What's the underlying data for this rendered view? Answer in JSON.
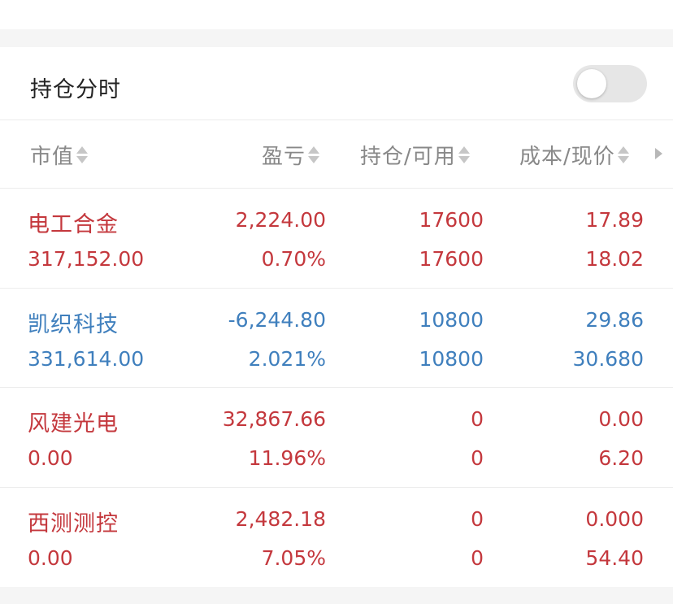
{
  "toggle_section": {
    "label": "持仓分时",
    "enabled": false
  },
  "table": {
    "headers": {
      "market_value": "市值",
      "profit_loss": "盈亏",
      "position_available": "持仓/可用",
      "cost_price": "成本/现价"
    },
    "rows": [
      {
        "name": "电工合金",
        "market_value": "317,152.00",
        "profit_loss": "2,224.00",
        "profit_loss_pct": "0.70%",
        "position": "17600",
        "available": "17600",
        "cost": "17.89",
        "price": "18.02",
        "color": "#c4383d"
      },
      {
        "name": "凯织科技",
        "market_value": "331,614.00",
        "profit_loss": "-6,244.80",
        "profit_loss_pct": "2.021%",
        "position": "10800",
        "available": "10800",
        "cost": "29.86",
        "price": "30.680",
        "color": "#3f7fbd"
      },
      {
        "name": "风建光电",
        "market_value": "0.00",
        "profit_loss": "32,867.66",
        "profit_loss_pct": "11.96%",
        "position": "0",
        "available": "0",
        "cost": "0.00",
        "price": "6.20",
        "color": "#c4383d"
      },
      {
        "name": "西测测控",
        "market_value": "0.00",
        "profit_loss": "2,482.18",
        "profit_loss_pct": "7.05%",
        "position": "0",
        "available": "0",
        "cost": "0.000",
        "price": "54.40",
        "color": "#c4383d"
      }
    ]
  }
}
